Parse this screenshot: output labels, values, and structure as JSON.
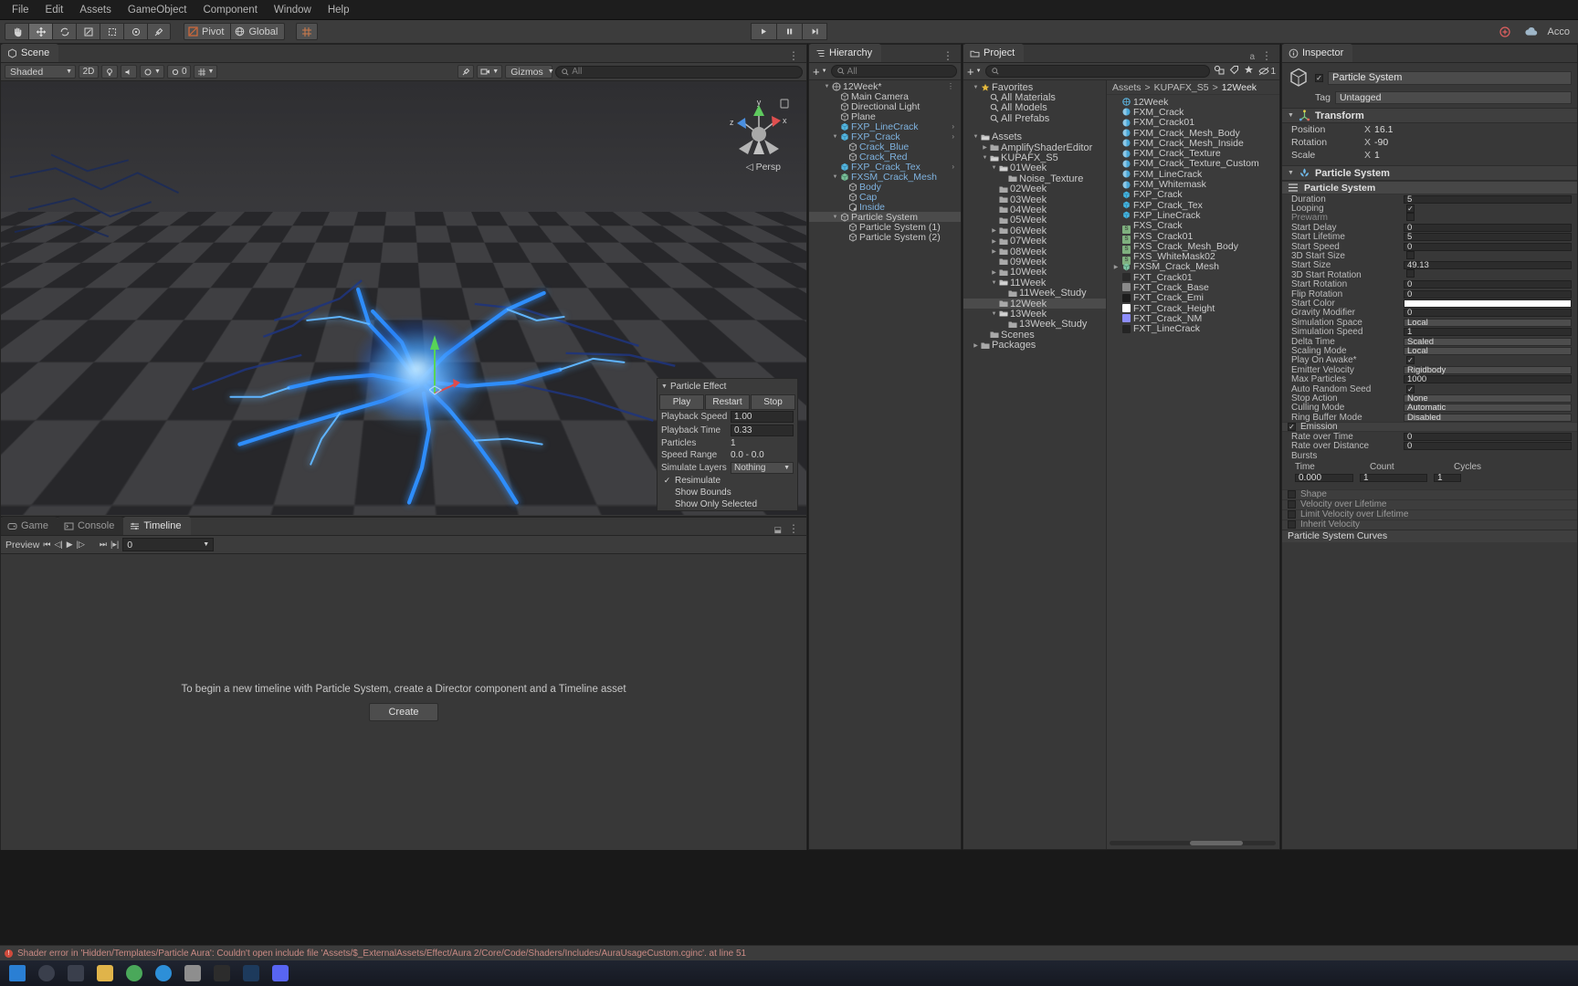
{
  "menubar": {
    "items": [
      "File",
      "Edit",
      "Assets",
      "GameObject",
      "Component",
      "Window",
      "Help"
    ]
  },
  "toolbar": {
    "tools": [
      "hand-tool",
      "move-tool",
      "rotate-tool",
      "scale-tool",
      "rect-tool",
      "transform-tool",
      "custom-tool"
    ],
    "pivot_label": "Pivot",
    "global_label": "Global",
    "grid_label": "grid-snap",
    "play_label": "play",
    "pause_label": "pause",
    "step_label": "step",
    "account_label": "Acco",
    "cloud_label": "cloud-icon",
    "collab_label": "collab-icon"
  },
  "scene": {
    "tab_label": "Scene",
    "shading_mode": "Shaded",
    "mode_2d": "2D",
    "gizmos_label": "Gizmos",
    "search_placeholder": "All",
    "lighting_value": "0",
    "persp_label": "Persp",
    "axis": {
      "x": "x",
      "y": "y",
      "z": "z"
    }
  },
  "particle_effect": {
    "title": "Particle Effect",
    "play": "Play",
    "restart": "Restart",
    "stop": "Stop",
    "rows": [
      {
        "label": "Playback Speed",
        "value": "1.00",
        "type": "field"
      },
      {
        "label": "Playback Time",
        "value": "0.33",
        "type": "field"
      },
      {
        "label": "Particles",
        "value": "1",
        "type": "text"
      },
      {
        "label": "Speed Range",
        "value": "0.0 - 0.0",
        "type": "text"
      },
      {
        "label": "Simulate Layers",
        "value": "Nothing",
        "type": "dropdown"
      }
    ],
    "checks": [
      {
        "label": "Resimulate",
        "checked": true
      },
      {
        "label": "Show Bounds",
        "checked": false
      },
      {
        "label": "Show Only Selected",
        "checked": false
      }
    ]
  },
  "bottom_tabs": {
    "game": "Game",
    "console": "Console",
    "timeline": "Timeline"
  },
  "timeline": {
    "preview_label": "Preview",
    "frame_value": "0",
    "empty_message": "To begin a new timeline with Particle System, create a Director component and a Timeline asset",
    "create_button": "Create"
  },
  "hierarchy": {
    "tab_label": "Hierarchy",
    "search_placeholder": "All",
    "add_label": "+",
    "items": [
      {
        "label": "12Week*",
        "depth": 0,
        "icon": "scene-icon",
        "expanded": true,
        "blue": false,
        "selected": false,
        "dots": true
      },
      {
        "label": "Main Camera",
        "depth": 1,
        "icon": "gameobject-icon",
        "blue": false
      },
      {
        "label": "Directional Light",
        "depth": 1,
        "icon": "gameobject-icon",
        "blue": false
      },
      {
        "label": "Plane",
        "depth": 1,
        "icon": "gameobject-icon",
        "blue": false
      },
      {
        "label": "FXP_LineCrack",
        "depth": 1,
        "icon": "prefab-icon",
        "blue": true,
        "chevron": true
      },
      {
        "label": "FXP_Crack",
        "depth": 1,
        "icon": "prefab-icon",
        "blue": true,
        "expanded": true,
        "chevron": true
      },
      {
        "label": "Crack_Blue",
        "depth": 2,
        "icon": "gameobject-icon",
        "blue": true
      },
      {
        "label": "Crack_Red",
        "depth": 2,
        "icon": "gameobject-icon",
        "blue": true
      },
      {
        "label": "FXP_Crack_Tex",
        "depth": 1,
        "icon": "prefab-icon",
        "blue": true,
        "chevron": true
      },
      {
        "label": "FXSM_Crack_Mesh",
        "depth": 1,
        "icon": "prefab-model-icon",
        "blue": true,
        "expanded": true
      },
      {
        "label": "Body",
        "depth": 2,
        "icon": "gameobject-icon",
        "blue": true
      },
      {
        "label": "Cap",
        "depth": 2,
        "icon": "gameobject-icon",
        "blue": true
      },
      {
        "label": "Inside",
        "depth": 2,
        "icon": "gameobject-particle-icon",
        "blue": true
      },
      {
        "label": "Particle System",
        "depth": 1,
        "icon": "gameobject-icon",
        "blue": false,
        "expanded": true,
        "selected": true
      },
      {
        "label": "Particle System (1)",
        "depth": 2,
        "icon": "gameobject-icon",
        "blue": false
      },
      {
        "label": "Particle System (2)",
        "depth": 2,
        "icon": "gameobject-icon",
        "blue": false
      }
    ]
  },
  "project": {
    "tab_label": "Project",
    "search_placeholder": "",
    "badge_count": "1",
    "breadcrumb": [
      "Assets",
      "KUPAFX_S5",
      "12Week"
    ],
    "tree": [
      {
        "label": "Favorites",
        "depth": 0,
        "icon": "star-icon",
        "expanded": true
      },
      {
        "label": "All Materials",
        "depth": 1,
        "icon": "search-icon"
      },
      {
        "label": "All Models",
        "depth": 1,
        "icon": "search-icon"
      },
      {
        "label": "All Prefabs",
        "depth": 1,
        "icon": "search-icon"
      },
      {
        "label": "",
        "depth": 0,
        "icon": "spacer"
      },
      {
        "label": "Assets",
        "depth": 0,
        "icon": "folder-open-icon",
        "expanded": true
      },
      {
        "label": "AmplifyShaderEditor",
        "depth": 1,
        "icon": "folder-icon",
        "collapsed": true
      },
      {
        "label": "KUPAFX_S5",
        "depth": 1,
        "icon": "folder-open-icon",
        "expanded": true
      },
      {
        "label": "01Week",
        "depth": 2,
        "icon": "folder-open-icon",
        "expanded": true
      },
      {
        "label": "Noise_Texture",
        "depth": 3,
        "icon": "folder-icon"
      },
      {
        "label": "02Week",
        "depth": 2,
        "icon": "folder-icon"
      },
      {
        "label": "03Week",
        "depth": 2,
        "icon": "folder-icon"
      },
      {
        "label": "04Week",
        "depth": 2,
        "icon": "folder-icon"
      },
      {
        "label": "05Week",
        "depth": 2,
        "icon": "folder-icon"
      },
      {
        "label": "06Week",
        "depth": 2,
        "icon": "folder-icon",
        "collapsed": true
      },
      {
        "label": "07Week",
        "depth": 2,
        "icon": "folder-icon",
        "collapsed": true
      },
      {
        "label": "08Week",
        "depth": 2,
        "icon": "folder-icon",
        "collapsed": true
      },
      {
        "label": "09Week",
        "depth": 2,
        "icon": "folder-icon"
      },
      {
        "label": "10Week",
        "depth": 2,
        "icon": "folder-icon",
        "collapsed": true
      },
      {
        "label": "11Week",
        "depth": 2,
        "icon": "folder-open-icon",
        "expanded": true
      },
      {
        "label": "11Week_Study",
        "depth": 3,
        "icon": "folder-icon"
      },
      {
        "label": "12Week",
        "depth": 2,
        "icon": "folder-icon",
        "selected": true
      },
      {
        "label": "13Week",
        "depth": 2,
        "icon": "folder-open-icon",
        "expanded": true
      },
      {
        "label": "13Week_Study",
        "depth": 3,
        "icon": "folder-icon"
      },
      {
        "label": "Scenes",
        "depth": 1,
        "icon": "folder-icon"
      },
      {
        "label": "Packages",
        "depth": 0,
        "icon": "folder-icon",
        "collapsed": true
      }
    ],
    "assets": [
      {
        "label": "12Week",
        "icon": "scene-asset",
        "color": "#3a9bd9"
      },
      {
        "label": "FXM_Crack",
        "icon": "material",
        "color": "#4aa8d8"
      },
      {
        "label": "FXM_Crack01",
        "icon": "material",
        "color": "#4aa8d8"
      },
      {
        "label": "FXM_Crack_Mesh_Body",
        "icon": "material",
        "color": "#4aa8d8"
      },
      {
        "label": "FXM_Crack_Mesh_Inside",
        "icon": "material",
        "color": "#4aa8d8"
      },
      {
        "label": "FXM_Crack_Texture",
        "icon": "material",
        "color": "#4aa8d8"
      },
      {
        "label": "FXM_Crack_Texture_Custom",
        "icon": "material",
        "color": "#4aa8d8"
      },
      {
        "label": "FXM_LineCrack",
        "icon": "material",
        "color": "#4aa8d8"
      },
      {
        "label": "FXM_Whitemask",
        "icon": "material",
        "color": "#4aa8d8"
      },
      {
        "label": "FXP_Crack",
        "icon": "prefab",
        "color": "#44b4e0"
      },
      {
        "label": "FXP_Crack_Tex",
        "icon": "prefab",
        "color": "#44b4e0"
      },
      {
        "label": "FXP_LineCrack",
        "icon": "prefab",
        "color": "#44b4e0"
      },
      {
        "label": "FXS_Crack",
        "icon": "shader",
        "color": "#7fb07f"
      },
      {
        "label": "FXS_Crack01",
        "icon": "shader",
        "color": "#7fb07f"
      },
      {
        "label": "FXS_Crack_Mesh_Body",
        "icon": "shader",
        "color": "#7fb07f"
      },
      {
        "label": "FXS_WhiteMask02",
        "icon": "shader",
        "color": "#7fb07f"
      },
      {
        "label": "FXSM_Crack_Mesh",
        "icon": "model",
        "color": "#44b4e0",
        "expandable": true
      },
      {
        "label": "FXT_Crack01",
        "icon": "texture",
        "color": "#2a2a2a"
      },
      {
        "label": "FXT_Crack_Base",
        "icon": "texture",
        "color": "#8a8a8a"
      },
      {
        "label": "FXT_Crack_Emi",
        "icon": "texture",
        "color": "#1c1c1c"
      },
      {
        "label": "FXT_Crack_Height",
        "icon": "texture",
        "color": "#ffffff"
      },
      {
        "label": "FXT_Crack_NM",
        "icon": "texture",
        "color": "#8d8dfb"
      },
      {
        "label": "FXT_LineCrack",
        "icon": "texture",
        "color": "#242424"
      }
    ]
  },
  "inspector": {
    "tab_label": "Inspector",
    "object_name": "Particle System",
    "object_enabled": true,
    "tag_label": "Tag",
    "tag_value": "Untagged",
    "transform": {
      "title": "Transform",
      "rows": [
        {
          "label": "Position",
          "axis": "X",
          "value": "16.1"
        },
        {
          "label": "Rotation",
          "axis": "X",
          "value": "-90"
        },
        {
          "label": "Scale",
          "axis": "X",
          "value": "1"
        }
      ]
    },
    "particle_system_component": "Particle System",
    "main_module": {
      "title": "Particle System",
      "rows": [
        {
          "label": "Duration",
          "value": "5",
          "type": "field"
        },
        {
          "label": "Looping",
          "value": "",
          "type": "checkbox",
          "checked": true
        },
        {
          "label": "Prewarm",
          "value": "",
          "type": "checkbox",
          "checked": false,
          "dim": true
        },
        {
          "label": "Start Delay",
          "value": "0",
          "type": "field"
        },
        {
          "label": "Start Lifetime",
          "value": "5",
          "type": "field"
        },
        {
          "label": "Start Speed",
          "value": "0",
          "type": "field"
        },
        {
          "label": "3D Start Size",
          "value": "",
          "type": "checkbox",
          "checked": false
        },
        {
          "label": "Start Size",
          "value": "49.13",
          "type": "field"
        },
        {
          "label": "3D Start Rotation",
          "value": "",
          "type": "checkbox",
          "checked": false
        },
        {
          "label": "Start Rotation",
          "value": "0",
          "type": "field"
        },
        {
          "label": "Flip Rotation",
          "value": "0",
          "type": "field"
        },
        {
          "label": "Start Color",
          "value": "",
          "type": "color",
          "color": "#ffffff"
        },
        {
          "label": "Gravity Modifier",
          "value": "0",
          "type": "field"
        },
        {
          "label": "Simulation Space",
          "value": "Local",
          "type": "dropdown"
        },
        {
          "label": "Simulation Speed",
          "value": "1",
          "type": "field"
        },
        {
          "label": "Delta Time",
          "value": "Scaled",
          "type": "dropdown"
        },
        {
          "label": "Scaling Mode",
          "value": "Local",
          "type": "dropdown"
        },
        {
          "label": "Play On Awake*",
          "value": "",
          "type": "checkbox",
          "checked": true
        },
        {
          "label": "Emitter Velocity",
          "value": "Rigidbody",
          "type": "dropdown"
        },
        {
          "label": "Max Particles",
          "value": "1000",
          "type": "field"
        },
        {
          "label": "Auto Random Seed",
          "value": "",
          "type": "checkbox",
          "checked": true
        },
        {
          "label": "Stop Action",
          "value": "None",
          "type": "dropdown"
        },
        {
          "label": "Culling Mode",
          "value": "Automatic",
          "type": "dropdown"
        },
        {
          "label": "Ring Buffer Mode",
          "value": "Disabled",
          "type": "dropdown"
        }
      ]
    },
    "emission_module": {
      "title": "Emission",
      "checked": true,
      "rows": [
        {
          "label": "Rate over Time",
          "value": "0",
          "type": "field"
        },
        {
          "label": "Rate over Distance",
          "value": "0",
          "type": "field"
        }
      ],
      "bursts_label": "Bursts",
      "burst_columns": [
        "Time",
        "Count",
        "Cycles"
      ],
      "burst_row": {
        "time": "0.000",
        "count": "1",
        "cycles": "1"
      }
    },
    "modules": [
      {
        "label": "Shape",
        "checked": false
      },
      {
        "label": "Velocity over Lifetime",
        "checked": false
      },
      {
        "label": "Limit Velocity over Lifetime",
        "checked": false
      },
      {
        "label": "Inherit Velocity",
        "checked": false
      }
    ],
    "curves_title": "Particle System Curves"
  },
  "status": {
    "message": "Shader error in 'Hidden/Templates/Particle Aura': Couldn't open include file 'Assets/$_ExternalAssets/Effect/Aura 2/Core/Code/Shaders/Includes/AuraUsageCustom.cginc'. at line 51"
  },
  "taskbar": {
    "items": [
      "start-icon",
      "search-icon",
      "task-view-icon",
      "explorer-icon",
      "chrome-icon",
      "edge-icon",
      "notepad-icon",
      "unity-icon",
      "photoshop-icon",
      "discord-icon"
    ]
  },
  "colors": {
    "accent_blue": "#2a7fd4",
    "panel_bg": "#383838",
    "toolbar_bg": "#3c3c3c",
    "error_red": "#d14b3c",
    "link_blue": "#7fb3e0"
  }
}
